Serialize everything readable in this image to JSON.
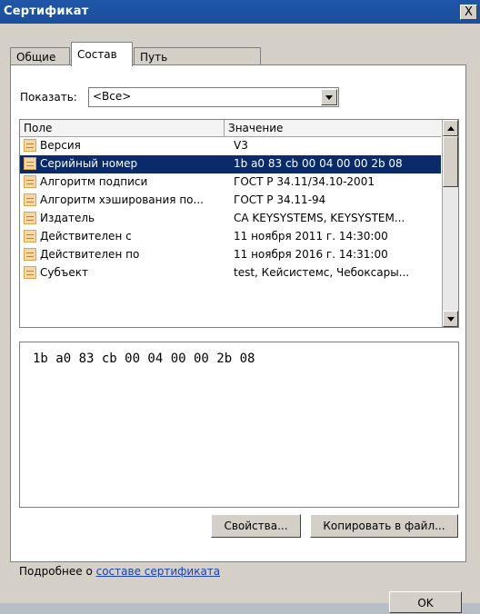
{
  "window": {
    "title": "Сертификат",
    "close_glyph": "X"
  },
  "tabs": [
    "Общие",
    "Состав",
    "Путь сертификации"
  ],
  "show": {
    "label": "Показать:",
    "value": "<Все>"
  },
  "list": {
    "columns": [
      "Поле",
      "Значение"
    ],
    "rows": [
      {
        "field": "Версия",
        "value": "V3"
      },
      {
        "field": "Серийный номер",
        "value": "1b a0 83 cb 00 04 00 00 2b 08",
        "selected": true
      },
      {
        "field": "Алгоритм подписи",
        "value": "ГОСТ Р 34.11/34.10-2001"
      },
      {
        "field": "Алгоритм хэширования по...",
        "value": "ГОСТ Р 34.11-94"
      },
      {
        "field": "Издатель",
        "value": "CA KEYSYSTEMS, KEYSYSTEM..."
      },
      {
        "field": "Действителен с",
        "value": "11 ноября 2011 г. 14:30:00"
      },
      {
        "field": "Действителен по",
        "value": "11 ноября 2016 г. 14:31:00"
      },
      {
        "field": "Субъект",
        "value": "test, Кейсистемс, Чебоксары..."
      }
    ]
  },
  "detail": {
    "text": "1b a0 83 cb 00 04 00 00 2b 08"
  },
  "buttons": {
    "properties": "Свойства...",
    "copy_to_file": "Копировать в файл...",
    "ok": "OK"
  },
  "more_info": {
    "prefix": "Подробнее о ",
    "link": "составе сертификата"
  }
}
